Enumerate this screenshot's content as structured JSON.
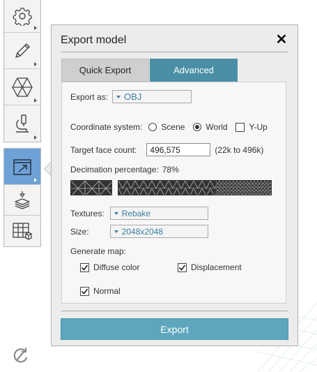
{
  "colors": {
    "accent": "#4a8fa5",
    "export_button": "#5da6be",
    "active_tool": "#6ea1d6",
    "select_text": "#3a7fa0"
  },
  "toolbar": {
    "tools": [
      {
        "name": "settings",
        "icon": "gear-icon"
      },
      {
        "name": "sculpt",
        "icon": "pencil-icon"
      },
      {
        "name": "mesh",
        "icon": "hexagon-mesh-icon"
      },
      {
        "name": "analysis",
        "icon": "microscope-icon"
      }
    ],
    "tools2": [
      {
        "name": "export",
        "icon": "export-icon",
        "active": true
      },
      {
        "name": "print",
        "icon": "print-icon"
      },
      {
        "name": "table",
        "icon": "table-icon"
      }
    ],
    "reset_icon": "reset-icon"
  },
  "panel": {
    "title": "Export model",
    "close_icon": "close-icon",
    "tabs": [
      {
        "label": "Quick Export",
        "active": false
      },
      {
        "label": "Advanced",
        "active": true
      }
    ],
    "export_as": {
      "label": "Export as:",
      "value": "OBJ"
    },
    "coordinate_system": {
      "label": "Coordinate system:",
      "options": [
        {
          "label": "Scene",
          "selected": false
        },
        {
          "label": "World",
          "selected": true
        }
      ],
      "y_up": {
        "label": "Y-Up",
        "checked": false
      }
    },
    "target_face_count": {
      "label": "Target face count:",
      "value": "496,575",
      "range": "(22k to 496k)"
    },
    "decimation": {
      "label": "Decimation percentage:",
      "value": "78%",
      "fraction": 0.78
    },
    "textures": {
      "label": "Textures:",
      "value": "Rebake"
    },
    "size": {
      "label": "Size:",
      "value": "2048x2048"
    },
    "generate_map": {
      "label": "Generate map:",
      "options": [
        {
          "label": "Diffuse color",
          "checked": true
        },
        {
          "label": "Displacement",
          "checked": true
        },
        {
          "label": "Normal",
          "checked": true
        }
      ]
    },
    "export_button": "Export"
  }
}
